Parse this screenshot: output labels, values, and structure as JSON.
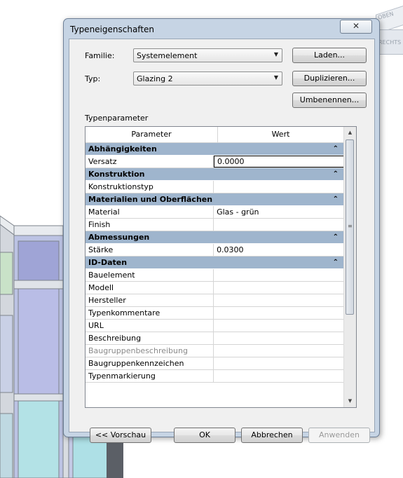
{
  "dialog": {
    "title": "Typeneigenschaften",
    "close_label": "✕",
    "family_label": "Familie:",
    "family_value": "Systemelement",
    "type_label": "Typ:",
    "type_value": "Glazing 2",
    "buttons": {
      "load": "Laden...",
      "duplicate": "Duplizieren...",
      "rename": "Umbenennen..."
    },
    "section_label": "Typenparameter",
    "columns": [
      "Parameter",
      "Wert"
    ],
    "groups": [
      {
        "name": "Abhängigkeiten",
        "rows": [
          {
            "name": "Versatz",
            "value": "0.0000",
            "editing": true
          }
        ]
      },
      {
        "name": "Konstruktion",
        "rows": [
          {
            "name": "Konstruktionstyp",
            "value": ""
          }
        ]
      },
      {
        "name": "Materialien und Oberflächen",
        "rows": [
          {
            "name": "Material",
            "value": "Glas - grün"
          },
          {
            "name": "Finish",
            "value": ""
          }
        ]
      },
      {
        "name": "Abmessungen",
        "rows": [
          {
            "name": "Stärke",
            "value": "0.0300"
          }
        ]
      },
      {
        "name": "ID-Daten",
        "rows": [
          {
            "name": "Bauelement",
            "value": ""
          },
          {
            "name": "Modell",
            "value": ""
          },
          {
            "name": "Hersteller",
            "value": ""
          },
          {
            "name": "Typenkommentare",
            "value": ""
          },
          {
            "name": "URL",
            "value": ""
          },
          {
            "name": "Beschreibung",
            "value": ""
          },
          {
            "name": "Baugruppenbeschreibung",
            "value": "",
            "disabled": true
          },
          {
            "name": "Baugruppenkennzeichen",
            "value": ""
          },
          {
            "name": "Typenmarkierung",
            "value": ""
          }
        ]
      }
    ],
    "footer": {
      "preview": "<< Vorschau",
      "ok": "OK",
      "cancel": "Abbrechen",
      "apply": "Anwenden"
    }
  },
  "viewcube": {
    "top_label": "OBEN",
    "side_label": "RECHTS"
  },
  "icons": {
    "collapse": "chevron-double-up-icon",
    "dropdown": "chevron-down-icon"
  },
  "colors": {
    "group_header": "#9fb5cd",
    "dialog_frame": "#c6d4e4",
    "glass_panel": "#9fa4d6"
  }
}
